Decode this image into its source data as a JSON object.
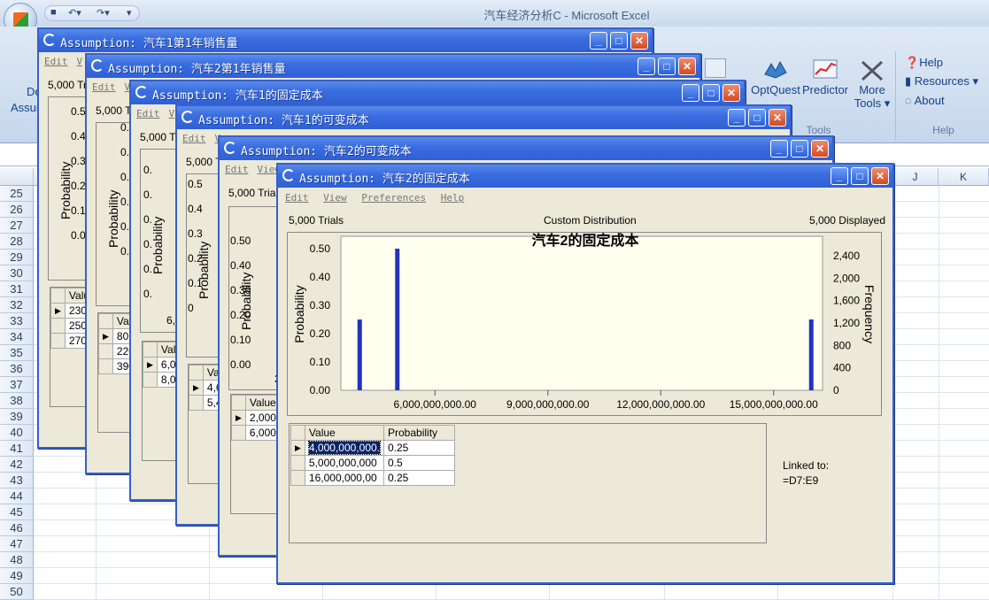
{
  "app_title": "汽车经济分析C - Microsoft Excel",
  "ribbon": {
    "left_btn1": "De",
    "left_btn2": "Assum",
    "optquest": "OptQuest",
    "predictor": "Predictor",
    "more_tools_1": "More",
    "more_tools_2": "Tools",
    "tools_group": "Tools",
    "help": "Help",
    "resources": "Resources",
    "about": "About",
    "help_group": "Help"
  },
  "columns": {
    "j": "J",
    "k": "K"
  },
  "rows": [
    "25",
    "26",
    "27",
    "28",
    "29",
    "30",
    "31",
    "32",
    "33",
    "34",
    "35",
    "36",
    "37",
    "38",
    "39",
    "40",
    "41",
    "42",
    "43",
    "44",
    "45",
    "46",
    "47",
    "48",
    "49",
    "50"
  ],
  "windows": [
    {
      "title": "Assumption: 汽车1第1年销售量",
      "menu": [
        "Edit",
        "V"
      ],
      "trials": "5,000 Trials",
      "yticks": [
        "0.5",
        "0.4",
        "0.3",
        "0.2",
        "0.1",
        "0.0"
      ],
      "ylabel": "Probability",
      "table_header": "Value",
      "values": [
        "230,",
        "250,",
        "270,"
      ]
    },
    {
      "title": "Assumption: 汽车2第1年销售量",
      "menu": [
        "Edit",
        "V"
      ],
      "trials": "5,000 T",
      "yticks": [
        "0.",
        "0.",
        "0.",
        "0.",
        "0.",
        "0."
      ],
      "ylabel": "Probability",
      "table_header": "Val",
      "values": [
        "80,0",
        "220",
        "390"
      ]
    },
    {
      "title": "Assumption: 汽车1的固定成本",
      "menu": [
        "Edit",
        "V"
      ],
      "trials": "5,000 T",
      "yticks": [
        "0.",
        "0.",
        "0.",
        "0.",
        "0.",
        "0."
      ],
      "ylabel": "Probability",
      "table_header": "Valu",
      "values": [
        "6,00",
        "8,00"
      ],
      "extra_tick": "6,0"
    },
    {
      "title": "Assumption: 汽车1的可变成本",
      "menu": [
        "Edit",
        "V"
      ],
      "trials": "5,000 T",
      "yticks": [
        "0.5",
        "0.4",
        "0.3",
        "0.2",
        "0.1",
        "0"
      ],
      "ylabel": "Probability",
      "table_header": "Val",
      "values": [
        "4,6",
        "5,4"
      ]
    },
    {
      "title": "Assumption: 汽车2的可变成本",
      "menu": [
        "Edit",
        "View"
      ],
      "trials": "5,000 Trials",
      "yticks": [
        "0.50",
        "0.40",
        "0.30",
        "0.20",
        "0.10",
        "0.00"
      ],
      "ylabel": "Probability",
      "table_header": "Value",
      "values": [
        "2,000",
        "6,000"
      ],
      "extra_tick": "2"
    }
  ],
  "front_window": {
    "title": "Assumption: 汽车2的固定成本",
    "menu": [
      "Edit",
      "View",
      "Preferences",
      "Help"
    ],
    "trials": "5,000 Trials",
    "distribution": "Custom Distribution",
    "displayed": "5,000 Displayed",
    "linked_label": "Linked to:",
    "linked_value": "=D7:E9",
    "table_headers": [
      "Value",
      "Probability"
    ],
    "table_rows": [
      {
        "value": "4,000,000,000.",
        "prob": "0.25"
      },
      {
        "value": "5,000,000,000",
        "prob": "0.5"
      },
      {
        "value": "16,000,000,00",
        "prob": "0.25"
      }
    ]
  },
  "chart_data": {
    "type": "bar",
    "title": "汽车2的固定成本",
    "ylabel": "Probability",
    "y2label": "Frequency",
    "x": [
      4000000000,
      5000000000,
      16000000000
    ],
    "values": [
      0.25,
      0.5,
      0.25
    ],
    "xlim": [
      3500000000,
      16300000000
    ],
    "ylim": [
      0,
      0.5
    ],
    "xticks": [
      "6,000,000,000.00",
      "9,000,000,000.00",
      "12,000,000,000.00",
      "15,000,000,000.00"
    ],
    "xtick_values": [
      6000000000,
      9000000000,
      12000000000,
      15000000000
    ],
    "yticks": [
      "0.50",
      "0.40",
      "0.30",
      "0.20",
      "0.10",
      "0.00"
    ],
    "y2ticks": [
      "2,400",
      "2,000",
      "1,600",
      "1,200",
      "800",
      "400",
      "0"
    ],
    "bar_color": "#2233bb",
    "plot_bg": "#fffff0"
  }
}
